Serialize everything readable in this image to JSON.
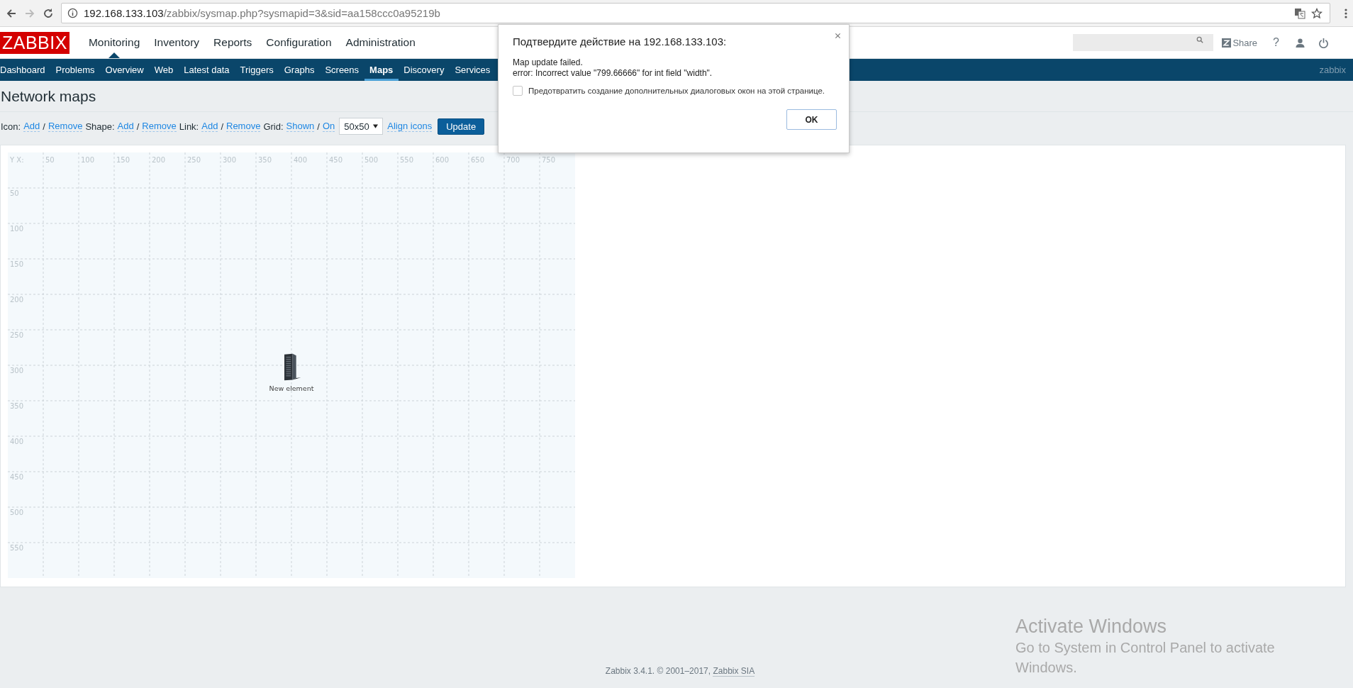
{
  "browser": {
    "url_host": "192.168.133.103",
    "url_path": "/zabbix/sysmap.php?sysmapid=3&sid=aa158ccc0a95219b"
  },
  "header": {
    "logo": "ZABBIX",
    "menu": [
      {
        "label": "Monitoring",
        "selected": true
      },
      {
        "label": "Inventory",
        "selected": false
      },
      {
        "label": "Reports",
        "selected": false
      },
      {
        "label": "Configuration",
        "selected": false
      },
      {
        "label": "Administration",
        "selected": false
      }
    ],
    "share": "Share",
    "help": "?"
  },
  "subnav": {
    "items": [
      {
        "label": "Dashboard",
        "selected": false
      },
      {
        "label": "Problems",
        "selected": false
      },
      {
        "label": "Overview",
        "selected": false
      },
      {
        "label": "Web",
        "selected": false
      },
      {
        "label": "Latest data",
        "selected": false
      },
      {
        "label": "Triggers",
        "selected": false
      },
      {
        "label": "Graphs",
        "selected": false
      },
      {
        "label": "Screens",
        "selected": false
      },
      {
        "label": "Maps",
        "selected": true
      },
      {
        "label": "Discovery",
        "selected": false
      },
      {
        "label": "Services",
        "selected": false
      }
    ],
    "user": "zabbix"
  },
  "page_title": "Network maps",
  "toolbar": {
    "groups": [
      {
        "label": "Icon:",
        "links": [
          "Add",
          "Remove"
        ],
        "separator": "/"
      },
      {
        "label": "Shape:",
        "links": [
          "Add",
          "Remove"
        ],
        "separator": "/"
      },
      {
        "label": "Link:",
        "links": [
          "Add",
          "Remove"
        ],
        "separator": "/"
      },
      {
        "label": "Grid:",
        "links": [
          "Shown",
          "On"
        ],
        "separator": "/"
      }
    ],
    "grid_size": "50x50",
    "align": "Align icons",
    "update": "Update"
  },
  "map": {
    "corner": "Y X:",
    "x_labels": [
      "50",
      "100",
      "150",
      "200",
      "250",
      "300",
      "350",
      "400",
      "450",
      "500",
      "550",
      "600",
      "650",
      "700",
      "750"
    ],
    "y_labels": [
      "50",
      "100",
      "150",
      "200",
      "250",
      "300",
      "350",
      "400",
      "450",
      "500",
      "550"
    ],
    "elements": [
      {
        "kind": "server",
        "label": "New element"
      }
    ]
  },
  "dialog": {
    "title": "Подтвердите действие на 192.168.133.103:",
    "message": [
      "Map update failed.",
      "error: Incorrect value \"799.66666\" for int field \"width\"."
    ],
    "checkbox": {
      "label": "Предотвратить создание дополнительных диалоговых окон на этой странице.",
      "checked": false
    },
    "ok": "OK"
  },
  "footer": {
    "text": "Zabbix 3.4.1. © 2001–2017, ",
    "link": "Zabbix SIA"
  },
  "os_notice": {
    "title": "Activate Windows",
    "text": "Go to System in Control Panel to activate Windows."
  }
}
